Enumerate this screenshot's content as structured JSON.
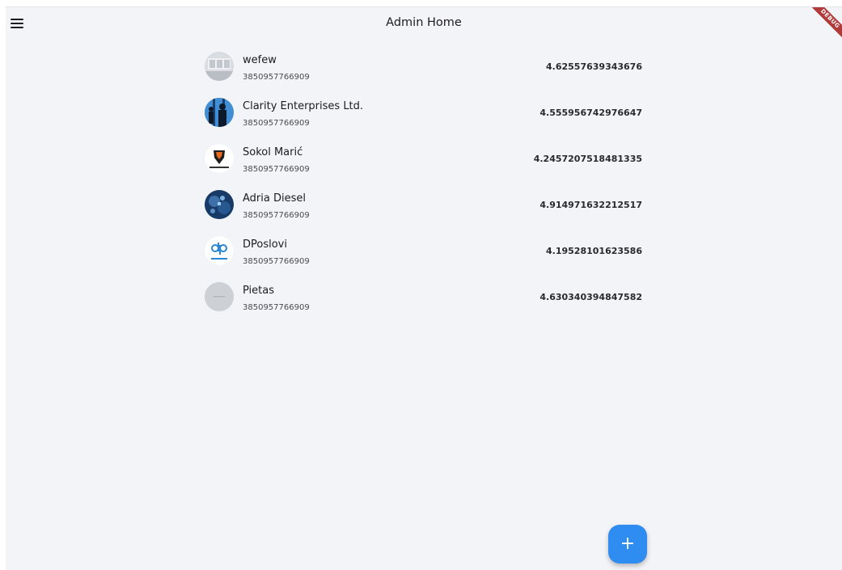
{
  "appbar": {
    "title": "Admin Home",
    "menu_icon": "hamburger-menu-icon",
    "debug_banner": "DEBUG"
  },
  "companies": [
    {
      "name": "wefew",
      "phone": "3850957766909",
      "score": "4.62557639343676",
      "avatar": "office-room-photo"
    },
    {
      "name": "Clarity Enterprises Ltd.",
      "phone": "3850957766909",
      "score": "4.555956742976647",
      "avatar": "business-people-silhouette"
    },
    {
      "name": "Sokol Marić",
      "phone": "3850957766909",
      "score": "4.2457207518481335",
      "avatar": "sokol-maric-logo"
    },
    {
      "name": "Adria Diesel",
      "phone": "3850957766909",
      "score": "4.914971632212517",
      "avatar": "adria-diesel-photo"
    },
    {
      "name": "DPoslovi",
      "phone": "3850957766909",
      "score": "4.19528101623586",
      "avatar": "dposlovi-logo"
    },
    {
      "name": "Pietas",
      "phone": "3850957766909",
      "score": "4.630340394847582",
      "avatar": "pietas-logo"
    }
  ],
  "fab": {
    "label": "+",
    "icon": "add-icon"
  },
  "colors": {
    "background": "#f2f4f8",
    "fab": "#2f8cf0",
    "debug": "#b13a3a"
  }
}
